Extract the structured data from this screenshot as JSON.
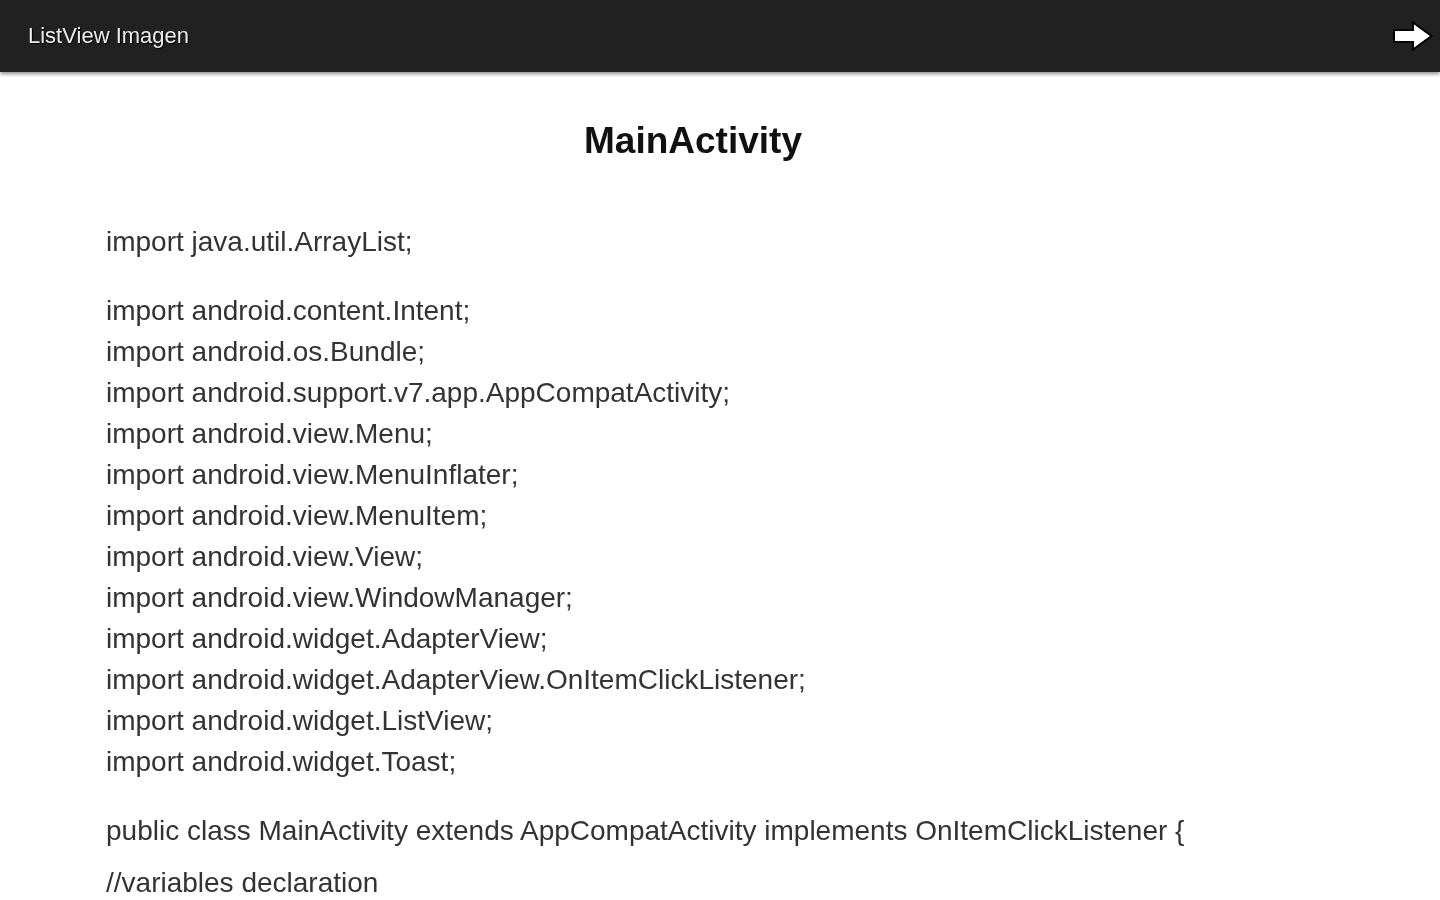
{
  "app_bar": {
    "title": "ListView Imagen"
  },
  "page": {
    "heading": "MainActivity",
    "paragraphs": [
      [
        "import java.util.ArrayList;"
      ],
      [
        "import android.content.Intent;",
        "import android.os.Bundle;",
        "import android.support.v7.app.AppCompatActivity;",
        "import android.view.Menu;",
        "import android.view.MenuInflater;",
        "import android.view.MenuItem;",
        "import android.view.View;",
        "import android.view.WindowManager;",
        "import android.widget.AdapterView;",
        "import android.widget.AdapterView.OnItemClickListener;",
        "import android.widget.ListView;",
        "import android.widget.Toast;"
      ],
      [
        "public class MainActivity extends AppCompatActivity implements OnItemClickListener {"
      ],
      [
        "//variables declaration"
      ]
    ]
  }
}
